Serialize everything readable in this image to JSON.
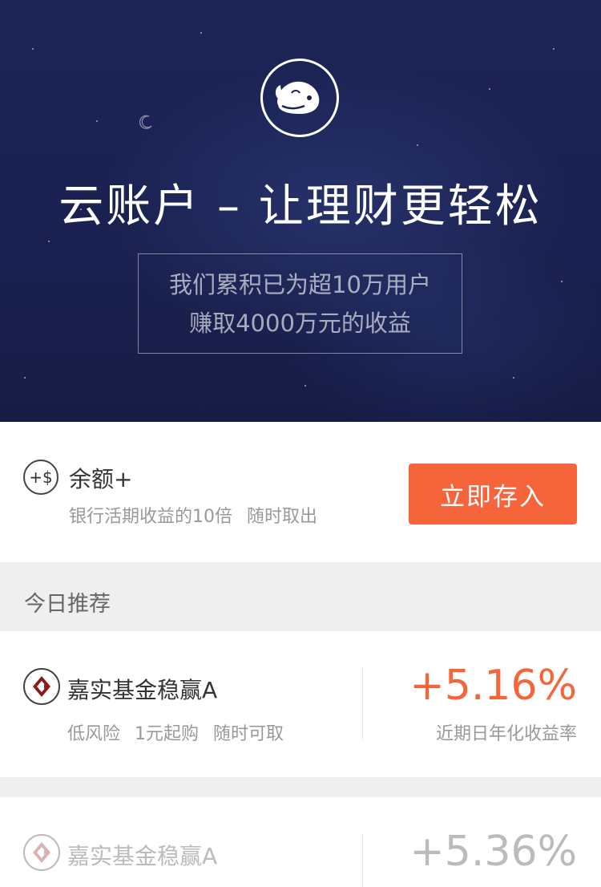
{
  "hero": {
    "title": "云账户 – 让理财更轻松",
    "subtitle_line1": "我们累积已为超10万用户",
    "subtitle_line2": "赚取4000万元的收益"
  },
  "balance": {
    "icon": "+$",
    "name": "余额+",
    "desc1": "银行活期收益的10倍",
    "desc2": "随时取出",
    "button_label": "立即存入"
  },
  "section": {
    "title": "今日推荐"
  },
  "products": [
    {
      "name": "嘉实基金稳赢A",
      "tags": [
        "低风险",
        "1元起购",
        "随时可取"
      ],
      "rate": "+5.16%",
      "rate_label": "近期日年化收益率"
    },
    {
      "name": "嘉实基金稳赢A",
      "rate": "+5.36%"
    }
  ],
  "colors": {
    "accent": "#f5643a",
    "hero_bg": "#1b2253",
    "fund_logo": "#8b1a1a"
  }
}
